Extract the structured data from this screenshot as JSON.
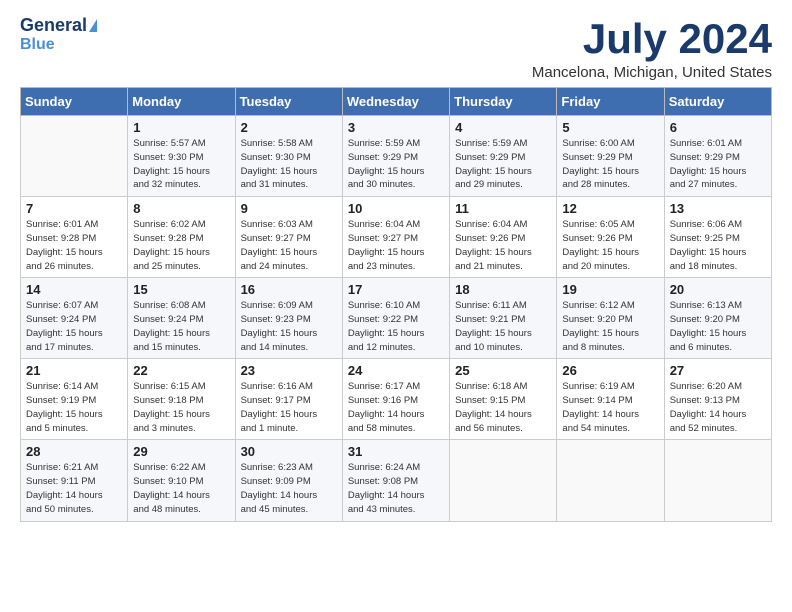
{
  "logo": {
    "line1": "General",
    "line2": "Blue"
  },
  "title": "July 2024",
  "location": "Mancelona, Michigan, United States",
  "weekdays": [
    "Sunday",
    "Monday",
    "Tuesday",
    "Wednesday",
    "Thursday",
    "Friday",
    "Saturday"
  ],
  "weeks": [
    [
      {
        "day": "",
        "info": ""
      },
      {
        "day": "1",
        "info": "Sunrise: 5:57 AM\nSunset: 9:30 PM\nDaylight: 15 hours\nand 32 minutes."
      },
      {
        "day": "2",
        "info": "Sunrise: 5:58 AM\nSunset: 9:30 PM\nDaylight: 15 hours\nand 31 minutes."
      },
      {
        "day": "3",
        "info": "Sunrise: 5:59 AM\nSunset: 9:29 PM\nDaylight: 15 hours\nand 30 minutes."
      },
      {
        "day": "4",
        "info": "Sunrise: 5:59 AM\nSunset: 9:29 PM\nDaylight: 15 hours\nand 29 minutes."
      },
      {
        "day": "5",
        "info": "Sunrise: 6:00 AM\nSunset: 9:29 PM\nDaylight: 15 hours\nand 28 minutes."
      },
      {
        "day": "6",
        "info": "Sunrise: 6:01 AM\nSunset: 9:29 PM\nDaylight: 15 hours\nand 27 minutes."
      }
    ],
    [
      {
        "day": "7",
        "info": "Sunrise: 6:01 AM\nSunset: 9:28 PM\nDaylight: 15 hours\nand 26 minutes."
      },
      {
        "day": "8",
        "info": "Sunrise: 6:02 AM\nSunset: 9:28 PM\nDaylight: 15 hours\nand 25 minutes."
      },
      {
        "day": "9",
        "info": "Sunrise: 6:03 AM\nSunset: 9:27 PM\nDaylight: 15 hours\nand 24 minutes."
      },
      {
        "day": "10",
        "info": "Sunrise: 6:04 AM\nSunset: 9:27 PM\nDaylight: 15 hours\nand 23 minutes."
      },
      {
        "day": "11",
        "info": "Sunrise: 6:04 AM\nSunset: 9:26 PM\nDaylight: 15 hours\nand 21 minutes."
      },
      {
        "day": "12",
        "info": "Sunrise: 6:05 AM\nSunset: 9:26 PM\nDaylight: 15 hours\nand 20 minutes."
      },
      {
        "day": "13",
        "info": "Sunrise: 6:06 AM\nSunset: 9:25 PM\nDaylight: 15 hours\nand 18 minutes."
      }
    ],
    [
      {
        "day": "14",
        "info": "Sunrise: 6:07 AM\nSunset: 9:24 PM\nDaylight: 15 hours\nand 17 minutes."
      },
      {
        "day": "15",
        "info": "Sunrise: 6:08 AM\nSunset: 9:24 PM\nDaylight: 15 hours\nand 15 minutes."
      },
      {
        "day": "16",
        "info": "Sunrise: 6:09 AM\nSunset: 9:23 PM\nDaylight: 15 hours\nand 14 minutes."
      },
      {
        "day": "17",
        "info": "Sunrise: 6:10 AM\nSunset: 9:22 PM\nDaylight: 15 hours\nand 12 minutes."
      },
      {
        "day": "18",
        "info": "Sunrise: 6:11 AM\nSunset: 9:21 PM\nDaylight: 15 hours\nand 10 minutes."
      },
      {
        "day": "19",
        "info": "Sunrise: 6:12 AM\nSunset: 9:20 PM\nDaylight: 15 hours\nand 8 minutes."
      },
      {
        "day": "20",
        "info": "Sunrise: 6:13 AM\nSunset: 9:20 PM\nDaylight: 15 hours\nand 6 minutes."
      }
    ],
    [
      {
        "day": "21",
        "info": "Sunrise: 6:14 AM\nSunset: 9:19 PM\nDaylight: 15 hours\nand 5 minutes."
      },
      {
        "day": "22",
        "info": "Sunrise: 6:15 AM\nSunset: 9:18 PM\nDaylight: 15 hours\nand 3 minutes."
      },
      {
        "day": "23",
        "info": "Sunrise: 6:16 AM\nSunset: 9:17 PM\nDaylight: 15 hours\nand 1 minute."
      },
      {
        "day": "24",
        "info": "Sunrise: 6:17 AM\nSunset: 9:16 PM\nDaylight: 14 hours\nand 58 minutes."
      },
      {
        "day": "25",
        "info": "Sunrise: 6:18 AM\nSunset: 9:15 PM\nDaylight: 14 hours\nand 56 minutes."
      },
      {
        "day": "26",
        "info": "Sunrise: 6:19 AM\nSunset: 9:14 PM\nDaylight: 14 hours\nand 54 minutes."
      },
      {
        "day": "27",
        "info": "Sunrise: 6:20 AM\nSunset: 9:13 PM\nDaylight: 14 hours\nand 52 minutes."
      }
    ],
    [
      {
        "day": "28",
        "info": "Sunrise: 6:21 AM\nSunset: 9:11 PM\nDaylight: 14 hours\nand 50 minutes."
      },
      {
        "day": "29",
        "info": "Sunrise: 6:22 AM\nSunset: 9:10 PM\nDaylight: 14 hours\nand 48 minutes."
      },
      {
        "day": "30",
        "info": "Sunrise: 6:23 AM\nSunset: 9:09 PM\nDaylight: 14 hours\nand 45 minutes."
      },
      {
        "day": "31",
        "info": "Sunrise: 6:24 AM\nSunset: 9:08 PM\nDaylight: 14 hours\nand 43 minutes."
      },
      {
        "day": "",
        "info": ""
      },
      {
        "day": "",
        "info": ""
      },
      {
        "day": "",
        "info": ""
      }
    ]
  ]
}
